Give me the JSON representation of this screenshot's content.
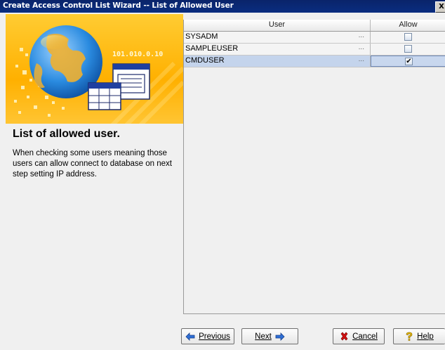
{
  "window": {
    "title": "Create Access Control List Wizard -- List of Allowed User",
    "close_glyph": "X"
  },
  "banner": {
    "ip_label": "101.010.0.10"
  },
  "left": {
    "heading": "List of allowed user.",
    "description": " When checking some users meaning those users can allow connect to database on next step setting IP address."
  },
  "table": {
    "columns": {
      "user": "User",
      "allow": "Allow"
    },
    "ellipsis": "...",
    "rows": [
      {
        "user": "SYSADM",
        "allow": false,
        "selected": false
      },
      {
        "user": "SAMPLEUSER",
        "allow": false,
        "selected": false
      },
      {
        "user": "CMDUSER",
        "allow": true,
        "selected": true
      }
    ]
  },
  "buttons": {
    "previous": "Previous",
    "next": "Next",
    "cancel": "Cancel",
    "help": "Help"
  },
  "icons": {
    "previous": "arrow-left-icon",
    "next": "arrow-right-icon",
    "cancel": "red-x-icon",
    "help": "question-mark-icon"
  },
  "colors": {
    "titlebar": "#0a246a",
    "banner": "#ffb000",
    "selected_row": "#c4d4ec",
    "arrow_blue": "#2f6fd6",
    "cancel_red": "#d01010",
    "help_yellow": "#f0c000"
  }
}
